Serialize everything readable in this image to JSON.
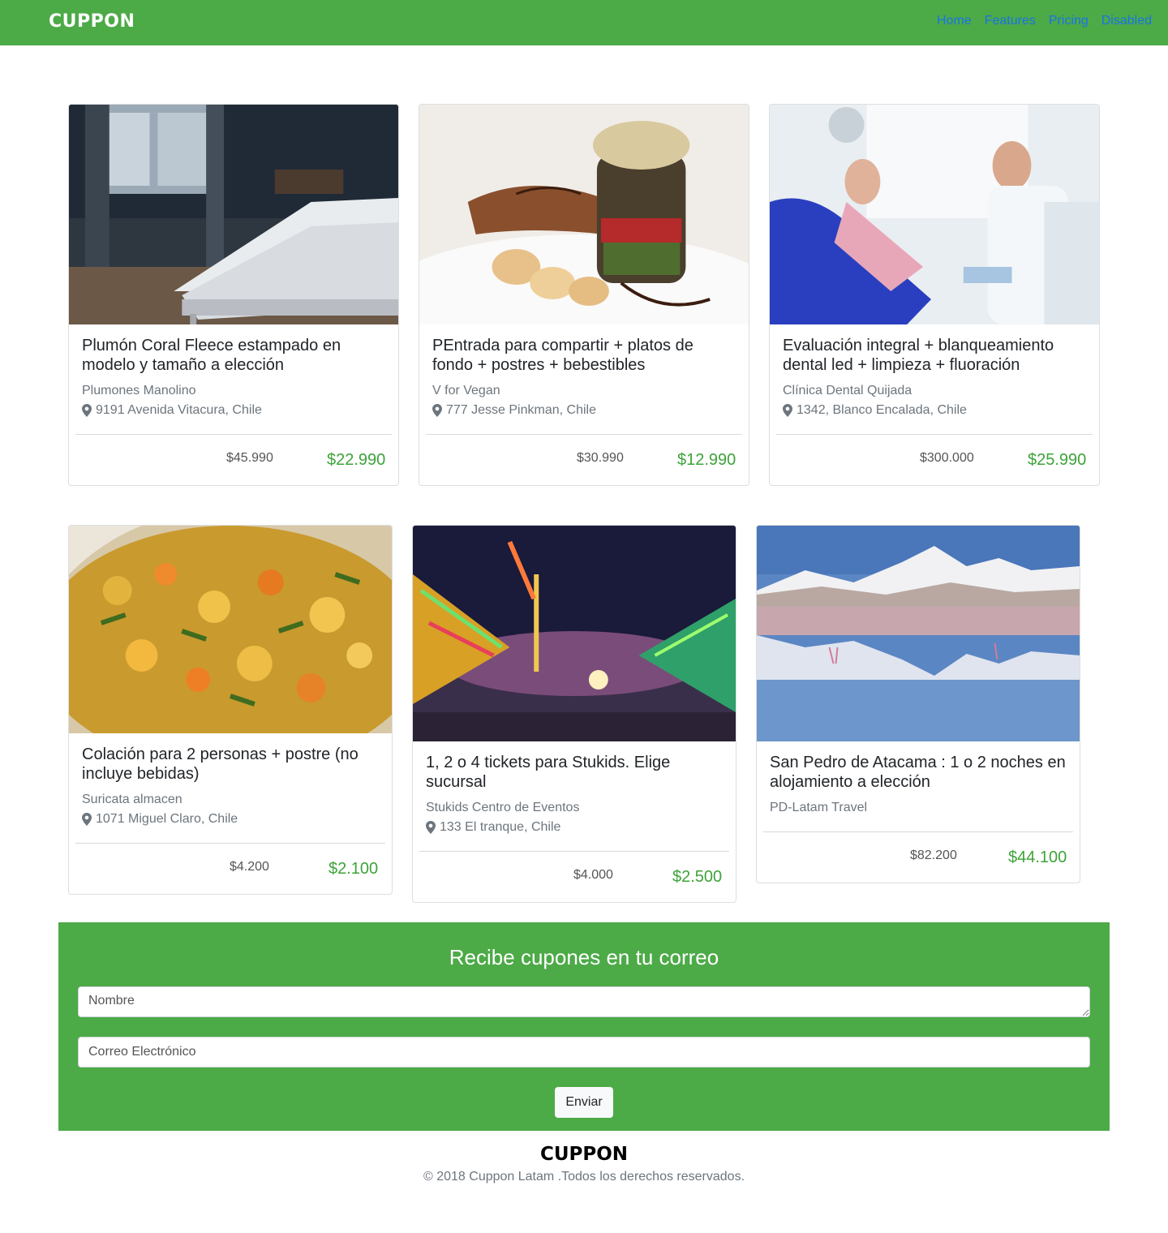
{
  "navbar": {
    "brand": "CUPPON",
    "links": [
      "Home",
      "Features",
      "Pricing",
      "Disabled"
    ]
  },
  "deals": [
    {
      "title": "Plumón Coral Fleece estampado en modelo y tamaño a elección",
      "vendor": "Plumones Manolino",
      "address": "9191 Avenida Vitacura, Chile",
      "old_price": "$45.990",
      "new_price": "$22.990",
      "image": "bedroom-photo"
    },
    {
      "title": "PEntrada para compartir + platos de fondo + postres + bebestibles",
      "vendor": "V for Vegan",
      "address": "777 Jesse Pinkman, Chile",
      "old_price": "$30.990",
      "new_price": "$12.990",
      "image": "vegan-dish-photo"
    },
    {
      "title": "Evaluación integral + blanqueamiento dental led + limpieza + fluoración",
      "vendor": "Clínica Dental Quijada",
      "address": "1342, Blanco Encalada, Chile",
      "old_price": "$300.000",
      "new_price": "$25.990",
      "image": "dentist-photo"
    },
    {
      "title": "Colación para 2 personas + postre (no incluye bebidas)",
      "vendor": "Suricata almacen",
      "address": "1071 Miguel Claro, Chile",
      "old_price": "$4.200",
      "new_price": "$2.100",
      "image": "food-bowl-photo"
    },
    {
      "title": "1, 2 o 4 tickets para Stukids. Elige sucursal",
      "vendor": "Stukids Centro de Eventos",
      "address": "133 El tranque, Chile",
      "old_price": "$4.000",
      "new_price": "$2.500",
      "image": "fairground-night-photo"
    },
    {
      "title": "San Pedro de Atacama : 1 o 2 noches en alojamiento a elección",
      "vendor": "PD-Latam Travel",
      "address": "",
      "old_price": "$82.200",
      "new_price": "$44.100",
      "image": "atacama-lagoon-photo"
    }
  ],
  "subscribe": {
    "title": "Recibe cupones en tu correo",
    "name_placeholder": "Nombre",
    "email_placeholder": "Correo Electrónico",
    "button_label": "Enviar"
  },
  "footer": {
    "brand": "CUPPON",
    "copyright": "© 2018 Cuppon Latam .Todos los derechos reservados."
  },
  "colors": {
    "brand_green": "#4caa47",
    "price_green": "#3ea33a",
    "link_blue": "#1a73e8"
  }
}
